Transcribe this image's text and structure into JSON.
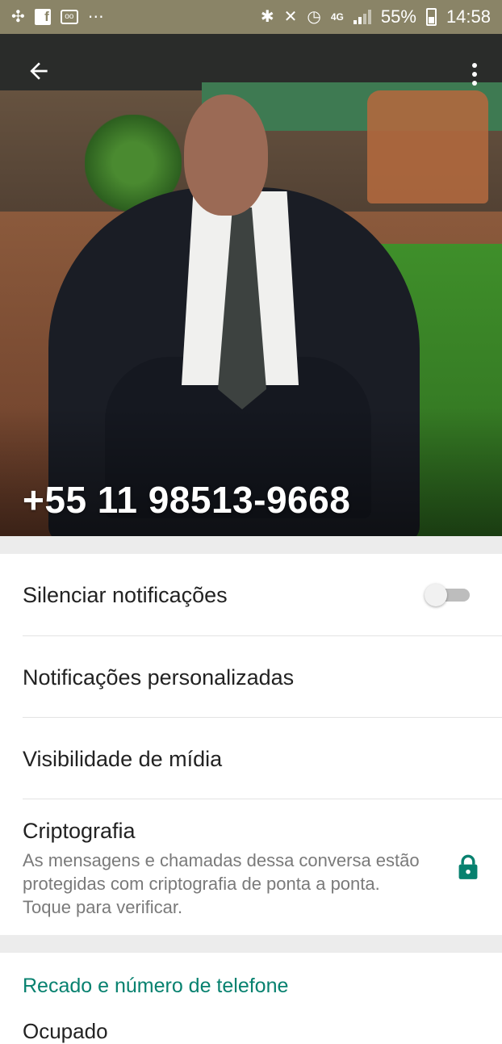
{
  "status_bar": {
    "battery": "55%",
    "time": "14:58",
    "network": "4G"
  },
  "header": {
    "contact_name": "+55 11 98513-9668",
    "back_icon": "arrow-left-icon",
    "menu_icon": "more-vert-icon"
  },
  "settings": {
    "mute_label": "Silenciar notificações",
    "mute_enabled": false,
    "custom_notifications_label": "Notificações personalizadas",
    "media_visibility_label": "Visibilidade de mídia",
    "encryption_title": "Criptografia",
    "encryption_desc": "As mensagens e chamadas dessa conversa estão protegidas com criptografia de ponta a ponta. Toque para verificar."
  },
  "about": {
    "section_title": "Recado e número de telefone",
    "status": "Ocupado"
  },
  "colors": {
    "status_bar": "#8a8467",
    "accent": "#07816f",
    "lock": "#07816f"
  }
}
